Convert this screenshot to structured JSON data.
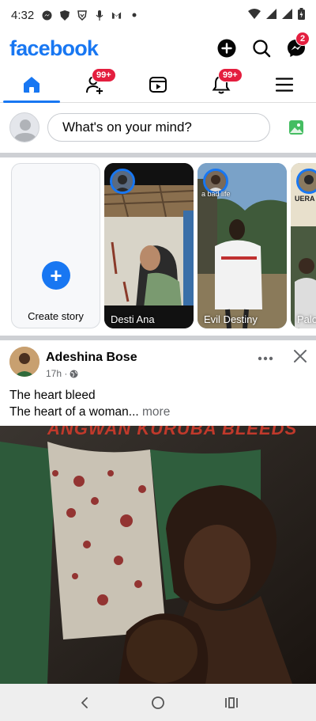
{
  "status_bar": {
    "time": "4:32",
    "left_icons": [
      "messenger-status-icon",
      "shield-icon",
      "brave-icon",
      "mic-icon",
      "gmail-icon",
      "dot-icon"
    ],
    "right_icons": [
      "wifi-icon",
      "signal-icon",
      "signal-icon",
      "battery-icon"
    ]
  },
  "header": {
    "logo": "facebook",
    "messenger_badge": "2"
  },
  "tabs": [
    {
      "name": "home",
      "active": true,
      "badge": ""
    },
    {
      "name": "friends",
      "active": false,
      "badge": "99+"
    },
    {
      "name": "watch",
      "active": false,
      "badge": ""
    },
    {
      "name": "notifications",
      "active": false,
      "badge": "99+"
    },
    {
      "name": "menu",
      "active": false,
      "badge": ""
    }
  ],
  "composer": {
    "placeholder": "What's on your mind?"
  },
  "stories": {
    "create_label": "Create story",
    "items": [
      {
        "name": "Desti Ana",
        "overlay": ""
      },
      {
        "name": "Evil Destiny",
        "overlay": "a bad life"
      },
      {
        "name": "Palo",
        "overlay": "UERA I UBIERA"
      }
    ]
  },
  "post": {
    "author": "Adeshina Bose",
    "time": "17h ·",
    "line1": "The heart bleed",
    "line2": "The heart of a woman...",
    "more_label": "more",
    "image_title": "ANGWAN KURUBA BLEEDS"
  },
  "colors": {
    "brand": "#1877f2",
    "badge": "#e41e3f"
  }
}
